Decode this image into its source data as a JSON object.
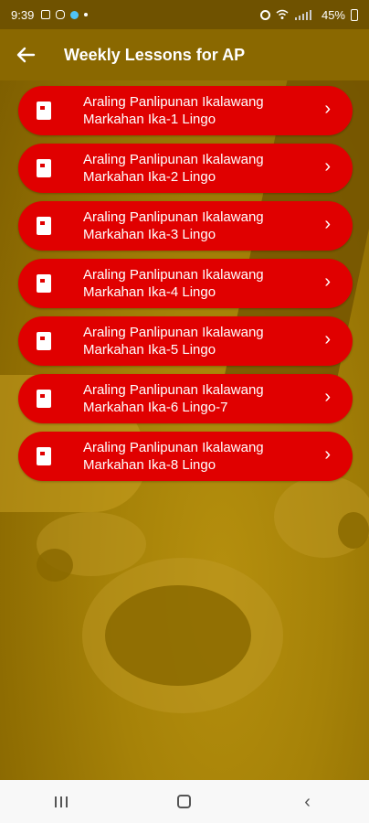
{
  "status_bar": {
    "time": "9:39",
    "battery_percent": "45%",
    "left_icons": [
      "gallery-icon",
      "instagram-icon",
      "app-icon",
      "dot-icon"
    ],
    "right_icons": [
      "alarm-icon",
      "wifi-icon",
      "signal-icon",
      "battery-icon"
    ]
  },
  "app_bar": {
    "back_icon": "arrow-left-icon",
    "title": "Weekly Lessons for AP"
  },
  "lessons": [
    {
      "line1": "Araling Panlipunan Ikalawang",
      "line2": "Markahan Ika-1 Lingo"
    },
    {
      "line1": "Araling Panlipunan Ikalawang",
      "line2": "Markahan Ika-2 Lingo"
    },
    {
      "line1": "Araling Panlipunan Ikalawang",
      "line2": "Markahan Ika-3 Lingo"
    },
    {
      "line1": "Araling Panlipunan Ikalawang",
      "line2": "Markahan Ika-4 Lingo"
    },
    {
      "line1": "Araling Panlipunan Ikalawang",
      "line2": "Markahan Ika-5 Lingo"
    },
    {
      "line1": "Araling Panlipunan Ikalawang",
      "line2": "Markahan Ika-6 Lingo-7"
    },
    {
      "line1": "Araling Panlipunan Ikalawang",
      "line2": "Markahan Ika-8 Lingo"
    }
  ],
  "theme": {
    "item_color": "#e00000",
    "app_bar_color": "#8a6800"
  },
  "nav_bar": {
    "icons": [
      "recents-icon",
      "home-icon",
      "back-icon"
    ]
  }
}
